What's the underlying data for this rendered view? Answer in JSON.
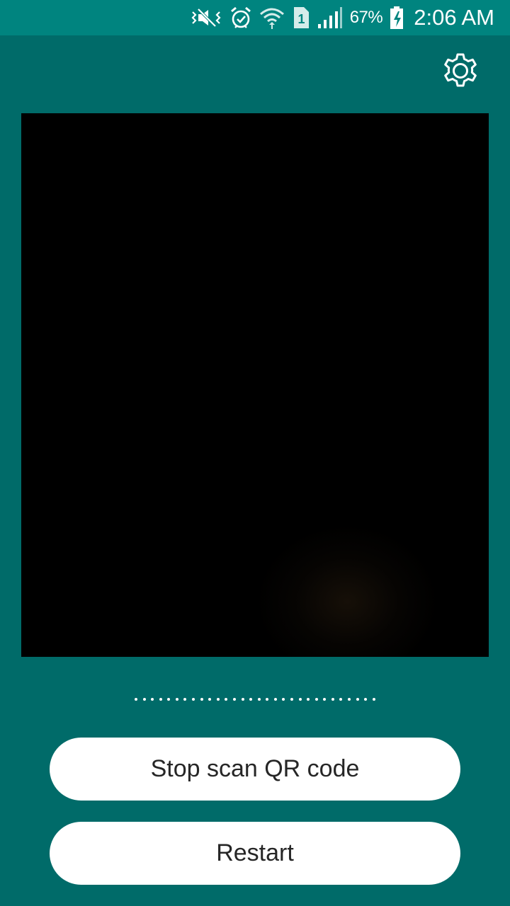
{
  "status_bar": {
    "icons": [
      "mute-vibrate-icon",
      "alarm-icon",
      "wifi-icon",
      "sim-1-icon",
      "signal-icon",
      "battery-charging-icon"
    ],
    "sim_label": "1",
    "battery_percent": "67%",
    "time": "2:06 AM"
  },
  "toolbar": {
    "settings_icon": "gear-icon"
  },
  "scanner": {
    "progress_dot_count": 30
  },
  "buttons": {
    "stop_label": "Stop scan QR code",
    "restart_label": "Restart"
  },
  "colors": {
    "background": "#006b69",
    "status_bar": "#00847f",
    "button_bg": "#ffffff",
    "button_text": "#262626"
  }
}
